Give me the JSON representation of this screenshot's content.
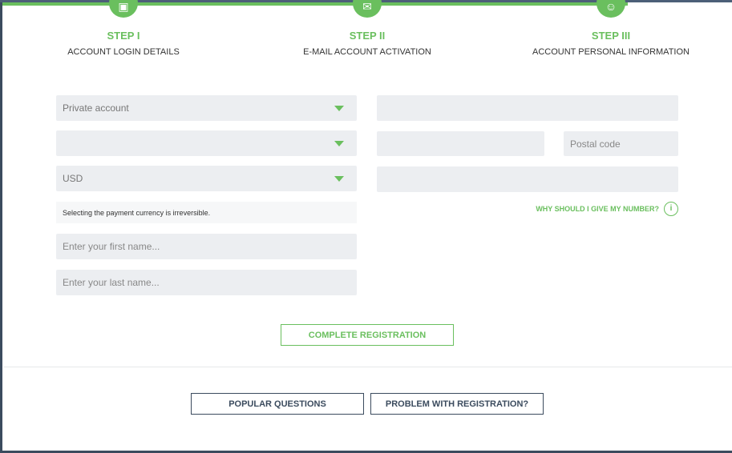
{
  "steps": [
    {
      "title": "STEP I",
      "subtitle": "ACCOUNT LOGIN DETAILS",
      "icon": "wallet-icon"
    },
    {
      "title": "STEP II",
      "subtitle": "E-MAIL ACCOUNT ACTIVATION",
      "icon": "envelope-icon"
    },
    {
      "title": "STEP III",
      "subtitle": "ACCOUNT PERSONAL INFORMATION",
      "icon": "user-icon"
    }
  ],
  "form": {
    "account_type": "Private account",
    "country": "",
    "currency": "USD",
    "currency_note": "Selecting the payment currency is irreversible.",
    "first_name_placeholder": "Enter your first name...",
    "last_name_placeholder": "Enter your last name...",
    "postal_code_placeholder": "Postal code",
    "why_number": "WHY SHOULD I GIVE MY NUMBER?",
    "info_glyph": "i",
    "submit": "COMPLETE REGISTRATION"
  },
  "footer": {
    "popular_questions": "POPULAR QUESTIONS",
    "problem": "PROBLEM WITH REGISTRATION?"
  },
  "colors": {
    "accent": "#6abf5e",
    "dark": "#3b4b5e"
  }
}
